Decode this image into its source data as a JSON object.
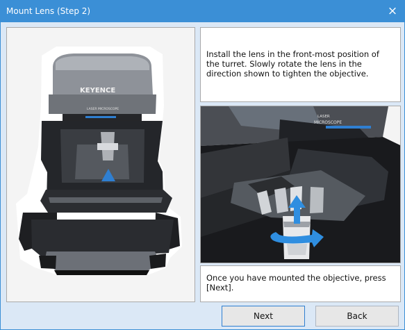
{
  "window": {
    "title": "Mount Lens (Step 2)",
    "close_glyph": "×"
  },
  "instructions": {
    "text": "Install the lens in the front-most position of the turret. Slowly rotate the lens in the direction shown to tighten the objective."
  },
  "footer": {
    "text": "Once you have mounted the objective, press [Next]."
  },
  "microscope": {
    "brand": "KEYENCE",
    "small_text": "LASER MICROSCOPE"
  },
  "buttons": {
    "next": "Next",
    "back": "Back"
  },
  "colors": {
    "title_bar": "#3b8fd6",
    "window_bg": "#dbe8f6",
    "accent": "#2f7fd1"
  },
  "icons": [
    "close-icon",
    "up-arrow-icon",
    "rotate-arrow-icon"
  ]
}
